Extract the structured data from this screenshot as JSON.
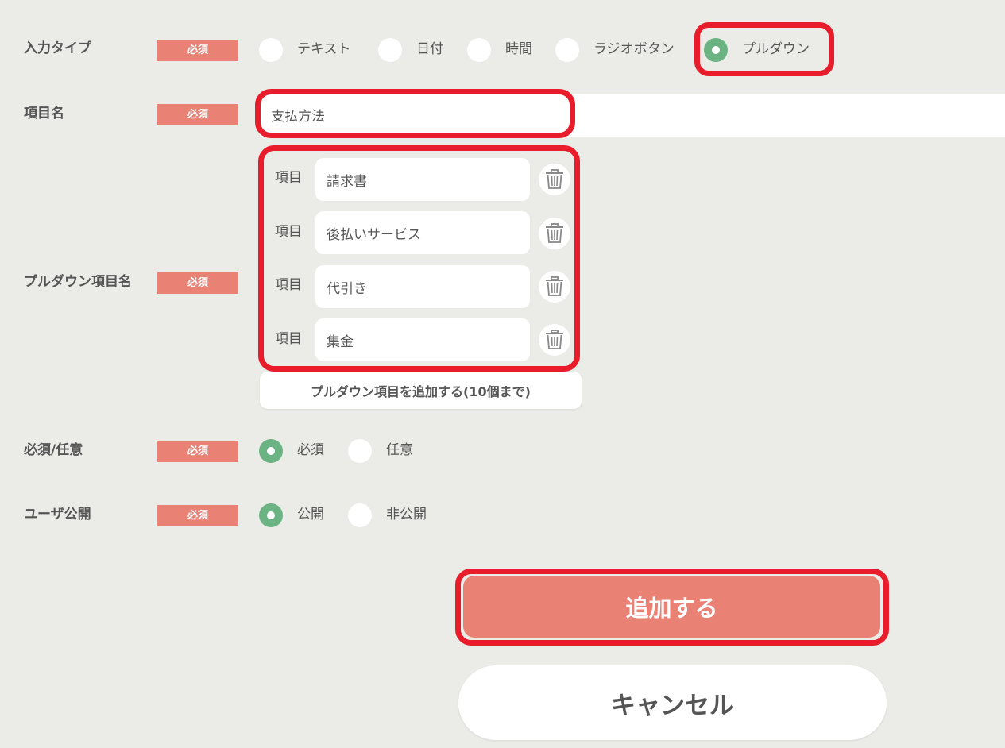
{
  "required_badge": "必須",
  "input_type": {
    "label": "入力タイプ",
    "options": [
      "テキスト",
      "日付",
      "時間",
      "ラジオボタン",
      "プルダウン"
    ],
    "selected": "プルダウン"
  },
  "item_name": {
    "label": "項目名",
    "value": "支払方法"
  },
  "pulldown": {
    "label": "プルダウン項目名",
    "item_prefix": "項目",
    "items": [
      "請求書",
      "後払いサービス",
      "代引き",
      "集金"
    ],
    "add_button": "プルダウン項目を追加する(10個まで)"
  },
  "required_optional": {
    "label": "必須/任意",
    "options": [
      "必須",
      "任意"
    ],
    "selected": "必須"
  },
  "user_public": {
    "label": "ユーザ公開",
    "options": [
      "公開",
      "非公開"
    ],
    "selected": "公開"
  },
  "actions": {
    "submit": "追加する",
    "cancel": "キャンセル"
  },
  "colors": {
    "background": "#ebece7",
    "badge": "#e98275",
    "radio_checked": "#6cb383",
    "highlight": "#e81c2a",
    "submit": "#e98275"
  }
}
